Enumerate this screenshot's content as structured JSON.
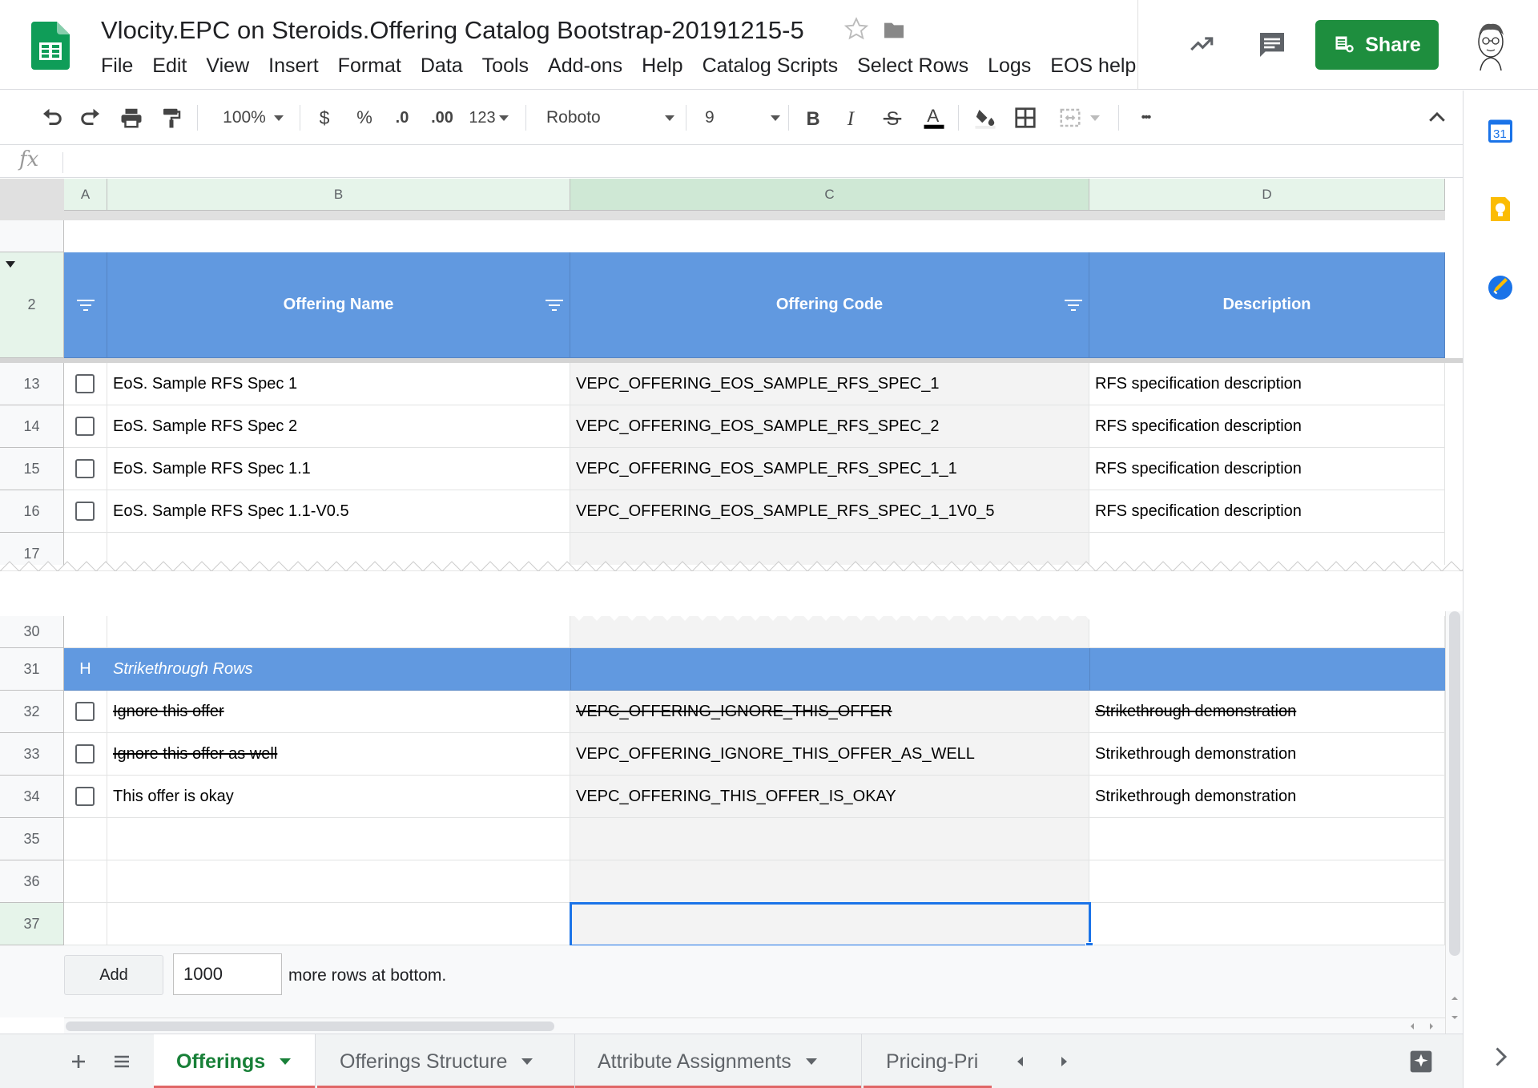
{
  "header": {
    "title": "Vlocity.EPC on Steroids.Offering Catalog Bootstrap-20191215-5",
    "share_label": "Share",
    "menu": [
      "File",
      "Edit",
      "View",
      "Insert",
      "Format",
      "Data",
      "Tools",
      "Add-ons",
      "Help",
      "Catalog Scripts",
      "Select Rows",
      "Logs",
      "EOS help"
    ]
  },
  "toolbar": {
    "zoom": "100%",
    "currency": "$",
    "percent": "%",
    "decrease_decimal": ".0",
    "increase_decimal": ".00",
    "more_formats": "123",
    "font": "Roboto",
    "font_size": "9",
    "more": "•••"
  },
  "grid": {
    "columns": [
      "A",
      "B",
      "C",
      "D"
    ],
    "header_row": {
      "number": "2",
      "b": "Offering Name",
      "c": "Offering Code",
      "d": "Description"
    },
    "rows_top": [
      {
        "num": "13",
        "name": "EoS. Sample RFS Spec 1",
        "code": "VEPC_OFFERING_EOS_SAMPLE_RFS_SPEC_1",
        "desc": "RFS specification description"
      },
      {
        "num": "14",
        "name": "EoS. Sample RFS Spec 2",
        "code": "VEPC_OFFERING_EOS_SAMPLE_RFS_SPEC_2",
        "desc": "RFS specification description"
      },
      {
        "num": "15",
        "name": "EoS. Sample RFS Spec 1.1",
        "code": "VEPC_OFFERING_EOS_SAMPLE_RFS_SPEC_1_1",
        "desc": "RFS specification description"
      },
      {
        "num": "16",
        "name": "EoS. Sample RFS Spec 1.1-V0.5",
        "code": "VEPC_OFFERING_EOS_SAMPLE_RFS_SPEC_1_1V0_5",
        "desc": "RFS specification description"
      },
      {
        "num": "17"
      }
    ],
    "row_30": "30",
    "section_row": {
      "num": "31",
      "marker": "H",
      "title": "Strikethrough Rows"
    },
    "rows_bottom": [
      {
        "num": "32",
        "name": "Ignore this offer",
        "code": "VEPC_OFFERING_IGNORE_THIS_OFFER",
        "desc": "Strikethrough demonstration"
      },
      {
        "num": "33",
        "name": "Ignore this offer as well",
        "code": "VEPC_OFFERING_IGNORE_THIS_OFFER_AS_WELL",
        "desc": "Strikethrough demonstration"
      },
      {
        "num": "34",
        "name": "This offer is okay",
        "code": "VEPC_OFFERING_THIS_OFFER_IS_OKAY",
        "desc": "Strikethrough demonstration"
      },
      {
        "num": "35"
      },
      {
        "num": "36"
      },
      {
        "num": "37"
      }
    ]
  },
  "add_rows": {
    "button_label": "Add",
    "count": "1000",
    "suffix": "more rows at bottom."
  },
  "sheets": [
    {
      "label": "Offerings",
      "active": true
    },
    {
      "label": "Offerings Structure"
    },
    {
      "label": "Attribute Assignments"
    },
    {
      "label": "Pricing-Pri"
    }
  ],
  "side_panel": {
    "calendar_day": "31"
  },
  "colors": {
    "header_blue": "#6199e0",
    "share_green": "#1e8e3e",
    "selection_blue": "#1a73e8",
    "active_tab_green": "#188038"
  }
}
